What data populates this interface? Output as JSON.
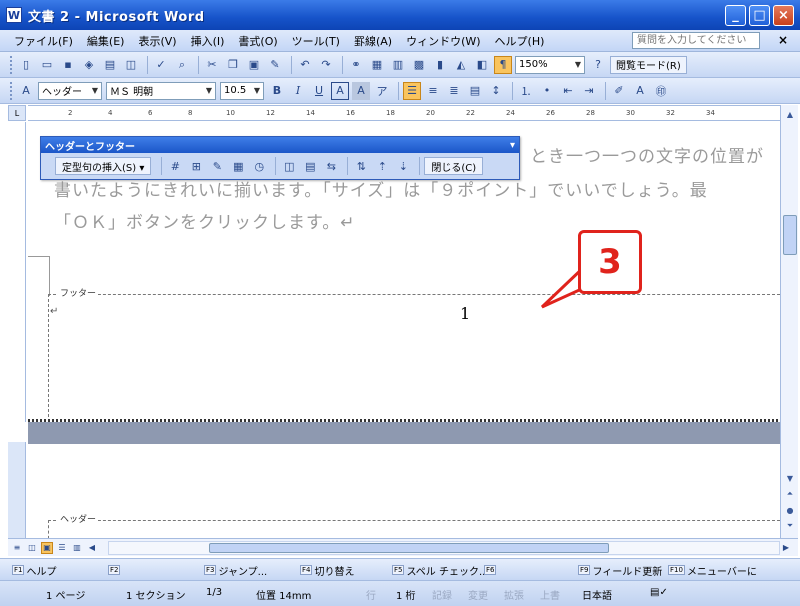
{
  "window": {
    "title": "文書 2 - Microsoft Word",
    "app_icon": "word-document-icon",
    "controls": [
      "_",
      "□",
      "×"
    ]
  },
  "menubar": {
    "items": [
      "ファイル(F)",
      "編集(E)",
      "表示(V)",
      "挿入(I)",
      "書式(O)",
      "ツール(T)",
      "罫線(A)",
      "ウィンドウ(W)",
      "ヘルプ(H)"
    ],
    "help_search_placeholder": "質問を入力してください",
    "close_label": "×"
  },
  "toolbar_standard": {
    "zoom": "150%",
    "reading_mode": "閲覧モード(R)"
  },
  "toolbar_format": {
    "style": "ヘッダー",
    "font": "ＭＳ 明朝",
    "size": "10.5",
    "bold": "B",
    "italic": "I",
    "underline": "U",
    "char_border": "A",
    "char_shading": "A"
  },
  "ruler": {
    "ticks": [
      "2",
      "4",
      "6",
      "8",
      "10",
      "12",
      "14",
      "16",
      "18",
      "20",
      "22",
      "24",
      "26",
      "28",
      "30",
      "32",
      "34"
    ]
  },
  "hf_toolbar": {
    "title": "ヘッダーとフッター",
    "insert_autotext": "定型句の挿入(S) ▾",
    "close": "閉じる(C)"
  },
  "document": {
    "line1": "とき一つ一つの文字の位置が",
    "line2": "書いたようにきれいに揃います。「サイズ」は「９ポイント」でいいでしょう。最",
    "line3": "「ＯＫ」ボタンをクリックします。↵",
    "footer_label": "フッター",
    "header_label": "ヘッダー",
    "page_number": "1",
    "return_mark": "↵"
  },
  "callout": {
    "number": "3",
    "color": "#e0231c"
  },
  "function_keys": [
    {
      "num": "F1",
      "label": "ヘルプ"
    },
    {
      "num": "F2",
      "label": ""
    },
    {
      "num": "F3",
      "label": "ジャンプ..."
    },
    {
      "num": "F4",
      "label": "切り替え"
    },
    {
      "num": "F5",
      "label": "スペル チェック..."
    },
    {
      "num": "F6",
      "label": ""
    },
    {
      "num": "F9",
      "label": "フィールド更新"
    },
    {
      "num": "F10",
      "label": "メニューバーに"
    }
  ],
  "statusbar": {
    "page": "1 ページ",
    "section": "1 セクション",
    "page_of": "1/3",
    "position": "位置 14mm",
    "line": "行",
    "column": "1 桁",
    "rec": "記録",
    "trk": "変更",
    "ext": "拡張",
    "ovr": "上書",
    "language": "日本語"
  }
}
